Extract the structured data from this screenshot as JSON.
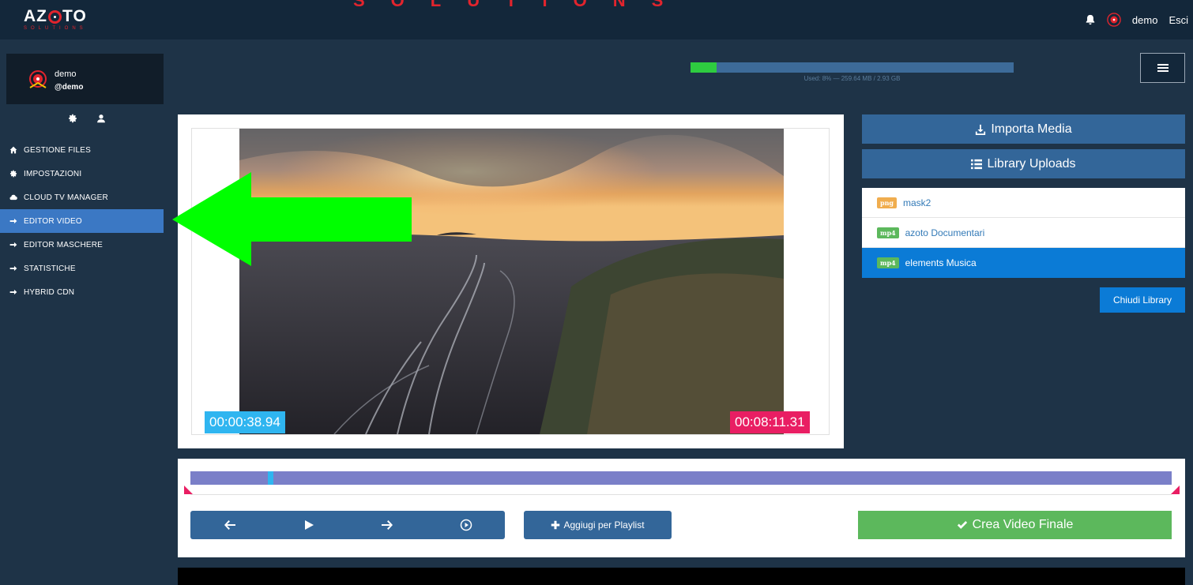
{
  "brand": {
    "logo_main_a": "AZ",
    "logo_main_b": "TO",
    "logo_sub": "SOLUTIONS",
    "banner_text": "SOLUTIONS"
  },
  "header": {
    "username": "demo",
    "logout_label": "Esci"
  },
  "user": {
    "name": "demo",
    "handle": "@demo"
  },
  "sidebar": {
    "items": [
      {
        "label": "GESTIONE FILES",
        "icon": "home-icon"
      },
      {
        "label": "IMPOSTAZIONI",
        "icon": "gear-icon"
      },
      {
        "label": "CLOUD TV MANAGER",
        "icon": "cloud-icon"
      },
      {
        "label": "EDITOR VIDEO",
        "icon": "arrow-right-icon",
        "active": true
      },
      {
        "label": "EDITOR MASCHERE",
        "icon": "arrow-right-icon"
      },
      {
        "label": "STATISTICHE",
        "icon": "arrow-right-icon"
      },
      {
        "label": "HYBRID CDN",
        "icon": "arrow-right-icon"
      }
    ]
  },
  "storage": {
    "used_percent": 8,
    "text": "Used: 8% — 259.64 MB / 2.93 GB"
  },
  "player": {
    "time_current": "00:00:38.94",
    "time_total": "00:08:11.31",
    "cursor_fraction": 0.079
  },
  "actions": {
    "import_label": "Importa Media",
    "library_label": "Library Uploads",
    "close_library_label": "Chiudi Library",
    "add_playlist_label": "Aggiugi per Playlist",
    "create_final_label": "Crea Video Finale"
  },
  "library": {
    "items": [
      {
        "type": "png",
        "name": "mask2",
        "selected": false
      },
      {
        "type": "mp4",
        "name": "azoto Documentari",
        "selected": false
      },
      {
        "type": "mp4",
        "name": "elements Musica",
        "selected": true
      }
    ]
  },
  "colors": {
    "accent_blue": "#336699",
    "active_blue": "#3b78c4",
    "success_green": "#5cb85c",
    "time_start": "#2fb5f0",
    "time_end": "#e91e63",
    "annotation_arrow": "#00ff00"
  }
}
